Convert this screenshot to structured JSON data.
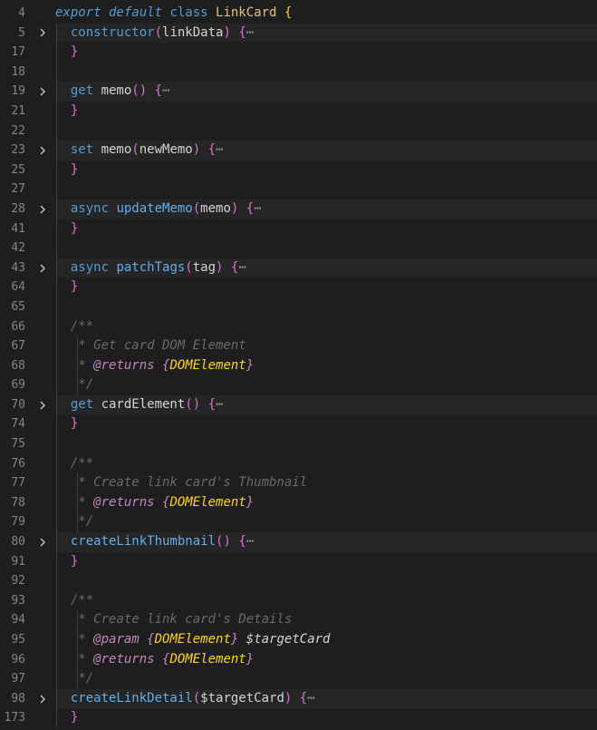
{
  "editor": {
    "lines": [
      {
        "num": "4",
        "fold": false,
        "folded": false,
        "tokens": [
          {
            "t": "export default ",
            "c": "kwi"
          },
          {
            "t": "class ",
            "c": "kw"
          },
          {
            "t": "LinkCard ",
            "c": "cls"
          },
          {
            "t": "{",
            "c": "brace"
          }
        ]
      },
      {
        "num": "5",
        "fold": true,
        "folded": true,
        "tokens": [
          {
            "t": "  constructor",
            "c": "kw"
          },
          {
            "t": "(",
            "c": "paren"
          },
          {
            "t": "linkData",
            "c": "param"
          },
          {
            "t": ") ",
            "c": "paren"
          },
          {
            "t": "{",
            "c": "brace2"
          },
          {
            "t": "⋯",
            "c": "ell"
          }
        ]
      },
      {
        "num": "17",
        "fold": false,
        "folded": false,
        "tokens": [
          {
            "t": "  }",
            "c": "brace2"
          }
        ]
      },
      {
        "num": "18",
        "fold": false,
        "folded": false,
        "tokens": []
      },
      {
        "num": "19",
        "fold": true,
        "folded": true,
        "tokens": [
          {
            "t": "  get ",
            "c": "kw"
          },
          {
            "t": "memo",
            "c": "param"
          },
          {
            "t": "() ",
            "c": "paren"
          },
          {
            "t": "{",
            "c": "brace2"
          },
          {
            "t": "⋯",
            "c": "ell"
          }
        ]
      },
      {
        "num": "21",
        "fold": false,
        "folded": false,
        "tokens": [
          {
            "t": "  }",
            "c": "brace2"
          }
        ]
      },
      {
        "num": "22",
        "fold": false,
        "folded": false,
        "tokens": []
      },
      {
        "num": "23",
        "fold": true,
        "folded": true,
        "tokens": [
          {
            "t": "  set ",
            "c": "kw"
          },
          {
            "t": "memo",
            "c": "param"
          },
          {
            "t": "(",
            "c": "paren"
          },
          {
            "t": "newMemo",
            "c": "param"
          },
          {
            "t": ") ",
            "c": "paren"
          },
          {
            "t": "{",
            "c": "brace2"
          },
          {
            "t": "⋯",
            "c": "ell"
          }
        ]
      },
      {
        "num": "25",
        "fold": false,
        "folded": false,
        "tokens": [
          {
            "t": "  }",
            "c": "brace2"
          }
        ]
      },
      {
        "num": "27",
        "fold": false,
        "folded": false,
        "tokens": []
      },
      {
        "num": "28",
        "fold": true,
        "folded": true,
        "tokens": [
          {
            "t": "  async ",
            "c": "kw"
          },
          {
            "t": "updateMemo",
            "c": "fn-b"
          },
          {
            "t": "(",
            "c": "paren"
          },
          {
            "t": "memo",
            "c": "param"
          },
          {
            "t": ") ",
            "c": "paren"
          },
          {
            "t": "{",
            "c": "brace2"
          },
          {
            "t": "⋯",
            "c": "ell"
          }
        ]
      },
      {
        "num": "41",
        "fold": false,
        "folded": false,
        "tokens": [
          {
            "t": "  }",
            "c": "brace2"
          }
        ]
      },
      {
        "num": "42",
        "fold": false,
        "folded": false,
        "tokens": []
      },
      {
        "num": "43",
        "fold": true,
        "folded": true,
        "tokens": [
          {
            "t": "  async ",
            "c": "kw"
          },
          {
            "t": "patchTags",
            "c": "fn-b"
          },
          {
            "t": "(",
            "c": "paren"
          },
          {
            "t": "tag",
            "c": "param"
          },
          {
            "t": ") ",
            "c": "paren"
          },
          {
            "t": "{",
            "c": "brace2"
          },
          {
            "t": "⋯",
            "c": "ell"
          }
        ]
      },
      {
        "num": "64",
        "fold": false,
        "folded": false,
        "tokens": [
          {
            "t": "  }",
            "c": "brace2"
          }
        ]
      },
      {
        "num": "65",
        "fold": false,
        "folded": false,
        "tokens": []
      },
      {
        "num": "66",
        "fold": false,
        "folded": false,
        "tokens": [
          {
            "t": "  /**",
            "c": "cmt"
          }
        ]
      },
      {
        "num": "67",
        "fold": false,
        "folded": false,
        "guide2": true,
        "tokens": [
          {
            "t": "   * Get card DOM Element",
            "c": "cmt"
          }
        ]
      },
      {
        "num": "68",
        "fold": false,
        "folded": false,
        "guide2": true,
        "tokens": [
          {
            "t": "   * ",
            "c": "cmt"
          },
          {
            "t": "@returns ",
            "c": "tag"
          },
          {
            "t": "{",
            "c": "tag"
          },
          {
            "t": "DOMElement",
            "c": "type"
          },
          {
            "t": "}",
            "c": "tag"
          }
        ]
      },
      {
        "num": "69",
        "fold": false,
        "folded": false,
        "guide2": true,
        "tokens": [
          {
            "t": "   */",
            "c": "cmt"
          }
        ]
      },
      {
        "num": "70",
        "fold": true,
        "folded": true,
        "tokens": [
          {
            "t": "  get ",
            "c": "kw"
          },
          {
            "t": "cardElement",
            "c": "param"
          },
          {
            "t": "() ",
            "c": "paren"
          },
          {
            "t": "{",
            "c": "brace2"
          },
          {
            "t": "⋯",
            "c": "ell"
          }
        ]
      },
      {
        "num": "74",
        "fold": false,
        "folded": false,
        "tokens": [
          {
            "t": "  }",
            "c": "brace2"
          }
        ]
      },
      {
        "num": "75",
        "fold": false,
        "folded": false,
        "tokens": []
      },
      {
        "num": "76",
        "fold": false,
        "folded": false,
        "tokens": [
          {
            "t": "  /**",
            "c": "cmt"
          }
        ]
      },
      {
        "num": "77",
        "fold": false,
        "folded": false,
        "guide2": true,
        "tokens": [
          {
            "t": "   * Create link card's Thumbnail",
            "c": "cmt"
          }
        ]
      },
      {
        "num": "78",
        "fold": false,
        "folded": false,
        "guide2": true,
        "tokens": [
          {
            "t": "   * ",
            "c": "cmt"
          },
          {
            "t": "@returns ",
            "c": "tag"
          },
          {
            "t": "{",
            "c": "tag"
          },
          {
            "t": "DOMElement",
            "c": "type"
          },
          {
            "t": "}",
            "c": "tag"
          }
        ]
      },
      {
        "num": "79",
        "fold": false,
        "folded": false,
        "guide2": true,
        "tokens": [
          {
            "t": "   */",
            "c": "cmt"
          }
        ]
      },
      {
        "num": "80",
        "fold": true,
        "folded": true,
        "tokens": [
          {
            "t": "  createLinkThumbnail",
            "c": "fn-b"
          },
          {
            "t": "() ",
            "c": "paren"
          },
          {
            "t": "{",
            "c": "brace2"
          },
          {
            "t": "⋯",
            "c": "ell"
          }
        ]
      },
      {
        "num": "91",
        "fold": false,
        "folded": false,
        "tokens": [
          {
            "t": "  }",
            "c": "brace2"
          }
        ]
      },
      {
        "num": "92",
        "fold": false,
        "folded": false,
        "tokens": []
      },
      {
        "num": "93",
        "fold": false,
        "folded": false,
        "tokens": [
          {
            "t": "  /**",
            "c": "cmt"
          }
        ]
      },
      {
        "num": "94",
        "fold": false,
        "folded": false,
        "guide2": true,
        "tokens": [
          {
            "t": "   * Create link card's Details",
            "c": "cmt"
          }
        ]
      },
      {
        "num": "95",
        "fold": false,
        "folded": false,
        "guide2": true,
        "tokens": [
          {
            "t": "   * ",
            "c": "cmt"
          },
          {
            "t": "@param ",
            "c": "tag"
          },
          {
            "t": "{",
            "c": "tag"
          },
          {
            "t": "DOMElement",
            "c": "type"
          },
          {
            "t": "} ",
            "c": "tag"
          },
          {
            "t": "$targetCard",
            "c": "var"
          }
        ]
      },
      {
        "num": "96",
        "fold": false,
        "folded": false,
        "guide2": true,
        "tokens": [
          {
            "t": "   * ",
            "c": "cmt"
          },
          {
            "t": "@returns ",
            "c": "tag"
          },
          {
            "t": "{",
            "c": "tag"
          },
          {
            "t": "DOMElement",
            "c": "type"
          },
          {
            "t": "}",
            "c": "tag"
          }
        ]
      },
      {
        "num": "97",
        "fold": false,
        "folded": false,
        "guide2": true,
        "tokens": [
          {
            "t": "   */",
            "c": "cmt"
          }
        ]
      },
      {
        "num": "98",
        "fold": true,
        "folded": true,
        "tokens": [
          {
            "t": "  createLinkDetail",
            "c": "fn-b"
          },
          {
            "t": "(",
            "c": "paren"
          },
          {
            "t": "$targetCard",
            "c": "param"
          },
          {
            "t": ") ",
            "c": "paren"
          },
          {
            "t": "{",
            "c": "brace2"
          },
          {
            "t": "⋯",
            "c": "ell"
          }
        ]
      },
      {
        "num": "173",
        "fold": false,
        "folded": false,
        "tokens": [
          {
            "t": "  }",
            "c": "brace2"
          }
        ]
      }
    ]
  }
}
